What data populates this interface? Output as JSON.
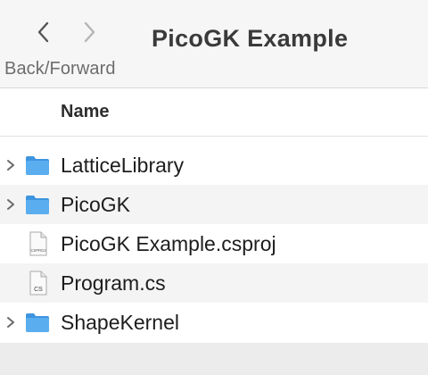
{
  "window": {
    "title": "PicoGK Example"
  },
  "toolbar": {
    "nav_label": "Back/Forward"
  },
  "columns": {
    "name": "Name"
  },
  "files": [
    {
      "name": "LatticeLibrary",
      "kind": "folder",
      "expandable": true
    },
    {
      "name": "PicoGK",
      "kind": "folder",
      "expandable": true
    },
    {
      "name": "PicoGK Example.csproj",
      "kind": "file",
      "badge": "CSPROJ",
      "expandable": false
    },
    {
      "name": "Program.cs",
      "kind": "file",
      "badge": "CS",
      "expandable": false
    },
    {
      "name": "ShapeKernel",
      "kind": "folder",
      "expandable": true
    }
  ],
  "colors": {
    "folder": "#5aaef0",
    "folder_dark": "#3e95df",
    "zebra": "#f4f4f4"
  }
}
